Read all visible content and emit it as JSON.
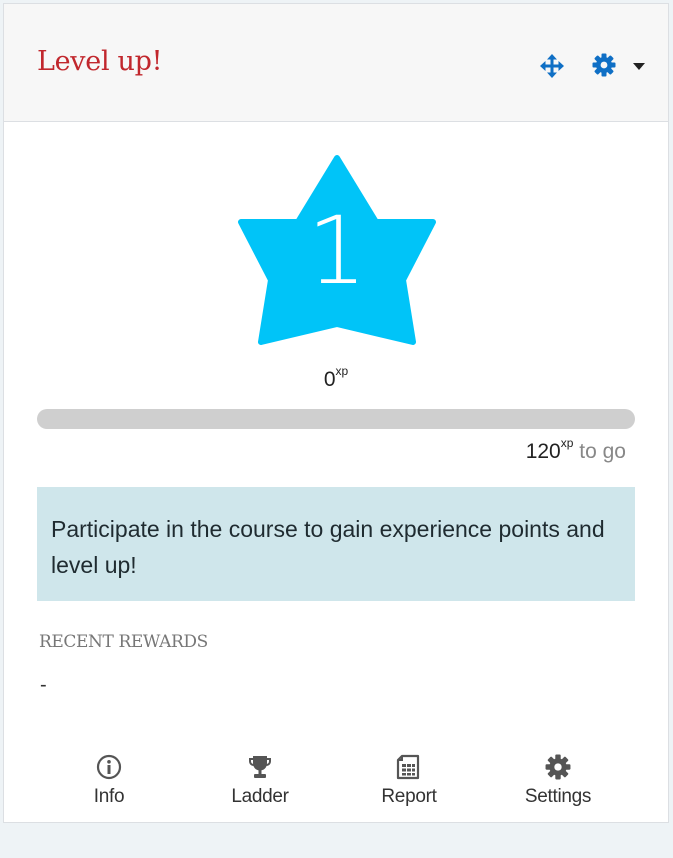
{
  "block": {
    "title": "Level up!",
    "controls": {
      "move_icon": "move-icon",
      "settings_icon": "gear-icon",
      "menu_icon": "caret-down-icon"
    }
  },
  "level": {
    "number": "1",
    "badge_icon": "star",
    "badge_color": "#00c4f8"
  },
  "xp": {
    "current": "0",
    "unit": "xp",
    "to_next": "120",
    "to_go_label": "to go",
    "progress_fraction": 0.0
  },
  "message": "Participate in the course to gain experience points and level up!",
  "recent_rewards": {
    "heading": "RECENT REWARDS",
    "empty_text": "-"
  },
  "footer_nav": [
    {
      "label": "Info",
      "icon": "info-icon"
    },
    {
      "label": "Ladder",
      "icon": "trophy-icon"
    },
    {
      "label": "Report",
      "icon": "report-icon"
    },
    {
      "label": "Settings",
      "icon": "gear-icon"
    }
  ],
  "colors": {
    "title": "#c1272d",
    "accent": "#0f6fc5",
    "star": "#00c4f8",
    "info_box": "#cfe6eb",
    "progress_track": "#cfcfcf"
  }
}
